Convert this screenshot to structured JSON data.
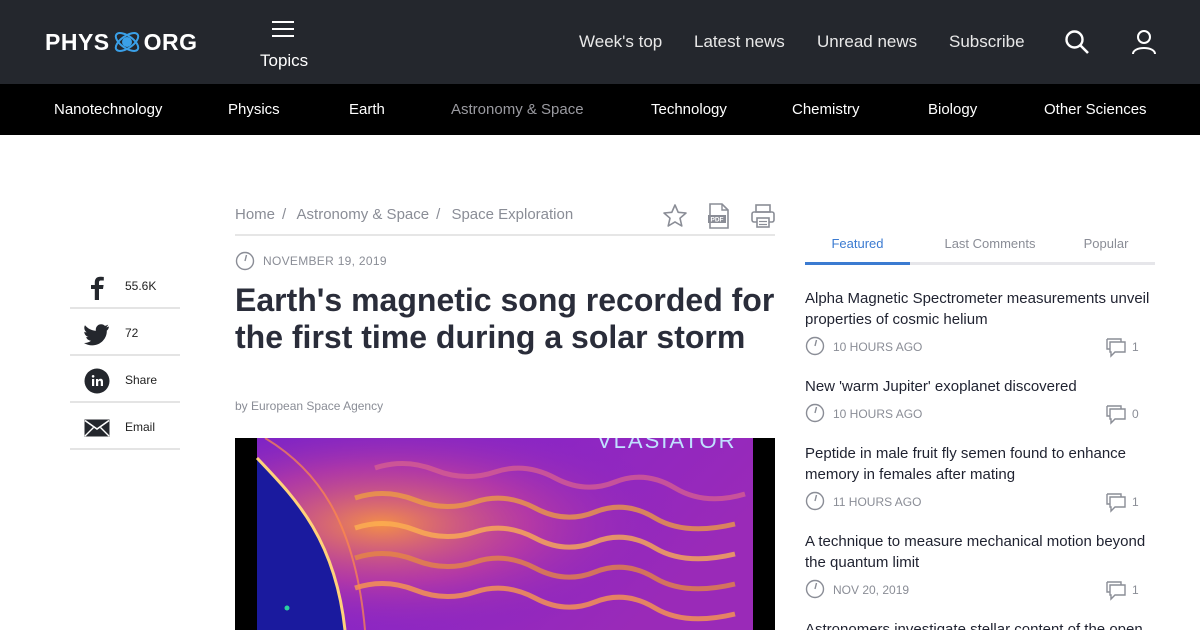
{
  "header": {
    "logo_left": "PHYS",
    "logo_right": "ORG",
    "topics_label": "Topics",
    "nav": [
      "Week's top",
      "Latest news",
      "Unread news",
      "Subscribe"
    ]
  },
  "categories": [
    "Nanotechnology",
    "Physics",
    "Earth",
    "Astronomy & Space",
    "Technology",
    "Chemistry",
    "Biology",
    "Other Sciences"
  ],
  "share": [
    {
      "icon": "facebook-icon",
      "text": "55.6K"
    },
    {
      "icon": "twitter-icon",
      "text": "72"
    },
    {
      "icon": "linkedin-icon",
      "text": "Share"
    },
    {
      "icon": "email-icon",
      "text": "Email"
    }
  ],
  "breadcrumb": [
    "Home",
    "Astronomy & Space",
    "Space Exploration"
  ],
  "article": {
    "date": "NOVEMBER 19, 2019",
    "title": "Earth's magnetic song recorded for the first time during a solar storm",
    "byline": "by European Space Agency",
    "image_caption_text": "VLASIATOR"
  },
  "sidebar": {
    "tabs": [
      "Featured",
      "Last Comments",
      "Popular"
    ],
    "items": [
      {
        "title": "Alpha Magnetic Spectrometer measurements unveil properties of cosmic helium",
        "time": "10 HOURS AGO",
        "comments": "1"
      },
      {
        "title": "New 'warm Jupiter' exoplanet discovered",
        "time": "10 HOURS AGO",
        "comments": "0"
      },
      {
        "title": "Peptide in male fruit fly semen found to enhance memory in females after mating",
        "time": "11 HOURS AGO",
        "comments": "1"
      },
      {
        "title": "A technique to measure mechanical motion beyond the quantum limit",
        "time": "NOV 20, 2019",
        "comments": "1"
      },
      {
        "title": "Astronomers investigate stellar content of the open",
        "time": "",
        "comments": ""
      }
    ]
  },
  "colors": {
    "topbar": "#24272d",
    "catbar": "#000000",
    "accent": "#3b7bd1"
  }
}
